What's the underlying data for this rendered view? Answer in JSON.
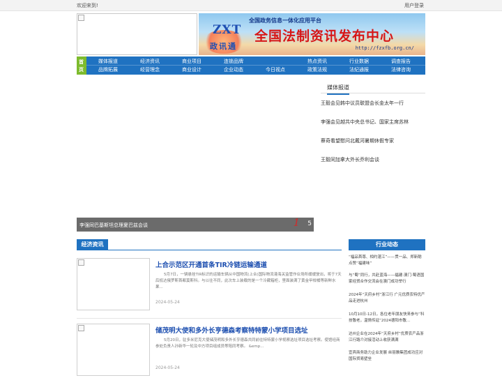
{
  "topbar": {
    "welcome": "欢迎来到!",
    "login": "用户登录"
  },
  "banner": {
    "tagline": "全国政务信息一体化应用平台",
    "logo_letters": "ZXT",
    "logo_cn": "政讯通",
    "title": "全国法制资讯发布中心",
    "url": "http://fzxfb.org.cn/"
  },
  "nav": {
    "home": [
      "首",
      "页"
    ],
    "row1": [
      "媒体报道",
      "经济资讯",
      "商业项目",
      "连锁品牌",
      "热点资讯",
      "行业数据",
      "调查报告"
    ],
    "row2": [
      "品牌拓展",
      "经营理念",
      "商业设计",
      "企业动态",
      "今日视点",
      "政策法规",
      "法纪通报",
      "法律咨询"
    ]
  },
  "slider": {
    "caption": "李强同巴基斯坦总理夏巴兹会谈",
    "active_index": "1",
    "count": "5"
  },
  "media": {
    "title": "媒体报道",
    "items": [
      "王毅会见韩中议员联盟会长金太年一行",
      "李强会见越共中央总书记、国家主席苏林",
      "蔡奇看望慰问北戴河暑期休假专家",
      "王毅同加拿大外长乔利会谈"
    ]
  },
  "economy": {
    "title": "经济资讯",
    "articles": [
      {
        "title": "上合示范区开通首条TIR冷链运输通道",
        "summary": "5月7日，一辆悬挂TIR标识的运输车辆从中国物流(上合)国际物流港海关监管作业场所缓缓驶出，将于7天后抵达俄罗斯首都莫斯科。与以往不同，此次车上装载的是一个冷藏箱柜，里面装满了黄金甲柑橘等新鲜水果...",
        "date": "2024-05-24"
      },
      {
        "title": "储茂明大使和多外长亨德森考察特特蒙小学项目选址",
        "summary": "5月20日，驻多米尼克大使储茂明和多外长亨德森共同前往特特蒙小学视察选址项目选址考察。使馆经商参处负责人孙新华一轮及中方项目组成员等陪同考察。 &emp...",
        "date": "2024-05-24"
      }
    ]
  },
  "industry": {
    "title": "行业动态",
    "items": [
      "“福品首尊、相约湛江”——贯一品、郑新聪点赞“福建味”",
      "与“蜀”同行，共赴蓝海——福建·澳门·蜀语国家经贸合作交流会在澳门成功举行",
      "2024年“天府乡村”浙江行 广元优质农特优产品走进杭州",
      "10月10日-12日，各位老年朋友快来参与“科技敬老，温情传延”2024德阳市敬...",
      "达州企业在2024年“天府乡村”优质农产品浙江行路介对接活动上收获满满",
      "宜宾商务助力企业发展 丝丽雅集团成功应对国际贸易壁垒"
    ]
  }
}
